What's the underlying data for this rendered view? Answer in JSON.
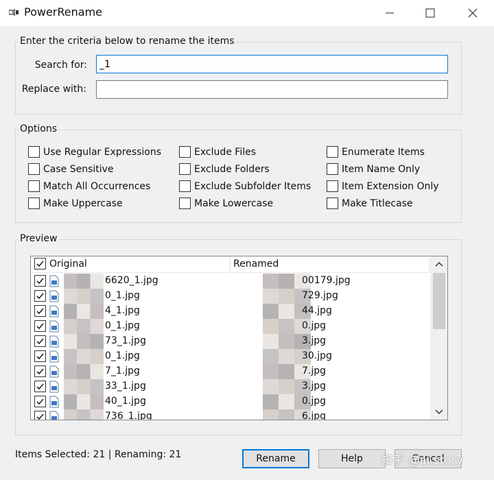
{
  "window": {
    "title": "PowerRename",
    "icon": "power-rename-icon"
  },
  "criteria": {
    "group_title": "Enter the criteria below to rename the items",
    "search_label": "Search for:",
    "search_value": "_1",
    "replace_label": "Replace with:",
    "replace_value": ""
  },
  "options": {
    "group_title": "Options",
    "col1": [
      "Use Regular Expressions",
      "Case Sensitive",
      "Match All Occurrences",
      "Make Uppercase"
    ],
    "col2": [
      "Exclude Files",
      "Exclude Folders",
      "Exclude Subfolder Items",
      "Make Lowercase"
    ],
    "col3": [
      "Enumerate Items",
      "Item Name Only",
      "Item Extension Only",
      "Make Titlecase"
    ]
  },
  "preview": {
    "group_title": "Preview",
    "col_original": "Original",
    "col_renamed": "Renamed",
    "rows": [
      {
        "original": "6620_1.jpg",
        "renamed": "00179.jpg"
      },
      {
        "original": "0_1.jpg",
        "renamed": "729.jpg"
      },
      {
        "original": "4_1.jpg",
        "renamed": "44.jpg"
      },
      {
        "original": "0_1.jpg",
        "renamed": "0.jpg"
      },
      {
        "original": "73_1.jpg",
        "renamed": "3.jpg"
      },
      {
        "original": "0_1.jpg",
        "renamed": "30.jpg"
      },
      {
        "original": "7_1.jpg",
        "renamed": "7.jpg"
      },
      {
        "original": "33_1.jpg",
        "renamed": "3.jpg"
      },
      {
        "original": "40_1.jpg",
        "renamed": "0.jpg"
      },
      {
        "original": "736_1.jpg",
        "renamed": "6.jpg"
      }
    ]
  },
  "status": {
    "text": "Items Selected: 21 | Renaming: 21"
  },
  "buttons": {
    "rename": "Rename",
    "help": "Help",
    "cancel": "Cancel"
  },
  "watermark": "知乎 @ai.story",
  "colors": {
    "accent": "#0078d7",
    "window_bg": "#f0f0f0"
  }
}
